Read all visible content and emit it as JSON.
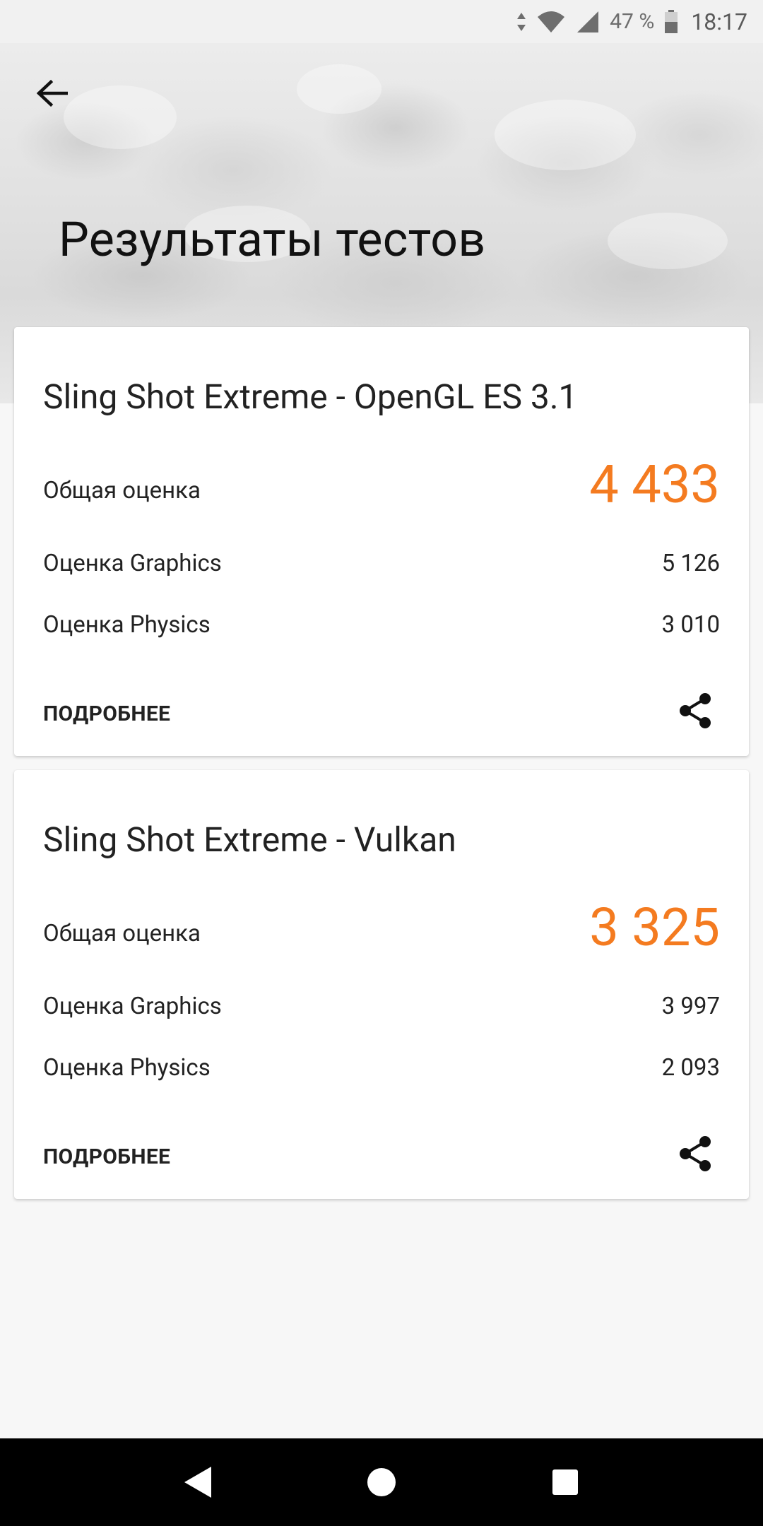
{
  "status_bar": {
    "battery_percent": "47 %",
    "time": "18:17"
  },
  "header": {
    "title": "Результаты тестов"
  },
  "results": [
    {
      "title": "Sling Shot Extreme - OpenGL ES 3.1",
      "total_label": "Общая оценка",
      "total_value": "4 433",
      "graphics_label": "Оценка Graphics",
      "graphics_value": "5 126",
      "physics_label": "Оценка Physics",
      "physics_value": "3 010",
      "details_label": "ПОДРОБНЕЕ"
    },
    {
      "title": "Sling Shot Extreme - Vulkan",
      "total_label": "Общая оценка",
      "total_value": "3 325",
      "graphics_label": "Оценка Graphics",
      "graphics_value": "3 997",
      "physics_label": "Оценка Physics",
      "physics_value": "2 093",
      "details_label": "ПОДРОБНЕЕ"
    }
  ],
  "colors": {
    "accent": "#f47b20"
  }
}
